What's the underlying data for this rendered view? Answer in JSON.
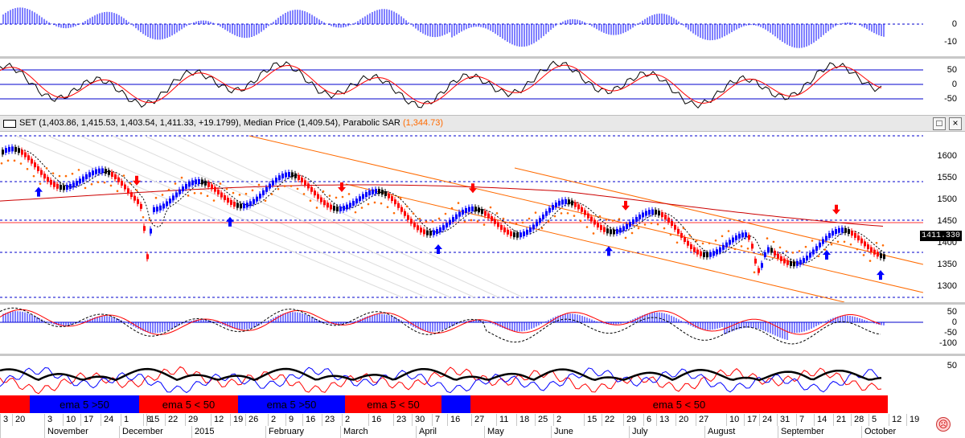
{
  "panes": {
    "hist": {
      "ticks": [
        "0",
        "-10"
      ]
    },
    "osc": {
      "ticks": [
        "50",
        "0",
        "-50"
      ]
    },
    "macd": {
      "ticks": [
        "50",
        "0",
        "-50",
        "-100"
      ]
    },
    "adx": {
      "ticks": [
        "50"
      ]
    }
  },
  "main": {
    "legend_symbol": "SET",
    "legend_values": "(1,403.86, 1,415.53, 1,403.54, 1,411.33, +19.1799),",
    "median_label": "Median Price (1,409.54),",
    "sar_label": "Parabolic SAR",
    "sar_value": "(1,344.73)",
    "price_ticks": [
      "1600",
      "1550",
      "1500",
      "1450",
      "1400",
      "1350",
      "1300"
    ],
    "last_price": "1411.330",
    "maximize_label": "□",
    "close_label": "×"
  },
  "ema_strip": [
    {
      "label": "",
      "color": "#ff0000"
    },
    {
      "label": "ema 5 >50",
      "color": "#0000ff"
    },
    {
      "label": "ema 5 < 50",
      "color": "#ff0000"
    },
    {
      "label": "ema 5 >50",
      "color": "#0000ff"
    },
    {
      "label": "ema 5 < 50",
      "color": "#ff0000"
    },
    {
      "label": "",
      "color": "#0000ff"
    },
    {
      "label": "ema 5 < 50",
      "color": "#ff0000"
    }
  ],
  "dates": [
    "3",
    "20",
    "3",
    "10",
    "17",
    "24",
    "1",
    "8",
    "15",
    "22",
    "29",
    "12",
    "19",
    "26",
    "2",
    "9",
    "16",
    "23",
    "2",
    "16",
    "23",
    "30",
    "7",
    "16",
    "27",
    "11",
    "18",
    "25",
    "2",
    "15",
    "22",
    "29",
    "6",
    "13",
    "20",
    "27",
    "10",
    "17",
    "24",
    "31",
    "7",
    "14",
    "21",
    "28",
    "5",
    "12",
    "19"
  ],
  "months": [
    "",
    "November",
    "December",
    "2015",
    "February",
    "March",
    "April",
    "May",
    "June",
    "July",
    "August",
    "September",
    "October"
  ],
  "colors": {
    "up": "#0000ff",
    "down": "#ff0000",
    "neutral": "#000000",
    "sar": "#ff6a00",
    "grid_blue": "#0000cc"
  },
  "icons": {
    "status": "sad-face-icon",
    "chart_type": "bar-chart-icon"
  }
}
